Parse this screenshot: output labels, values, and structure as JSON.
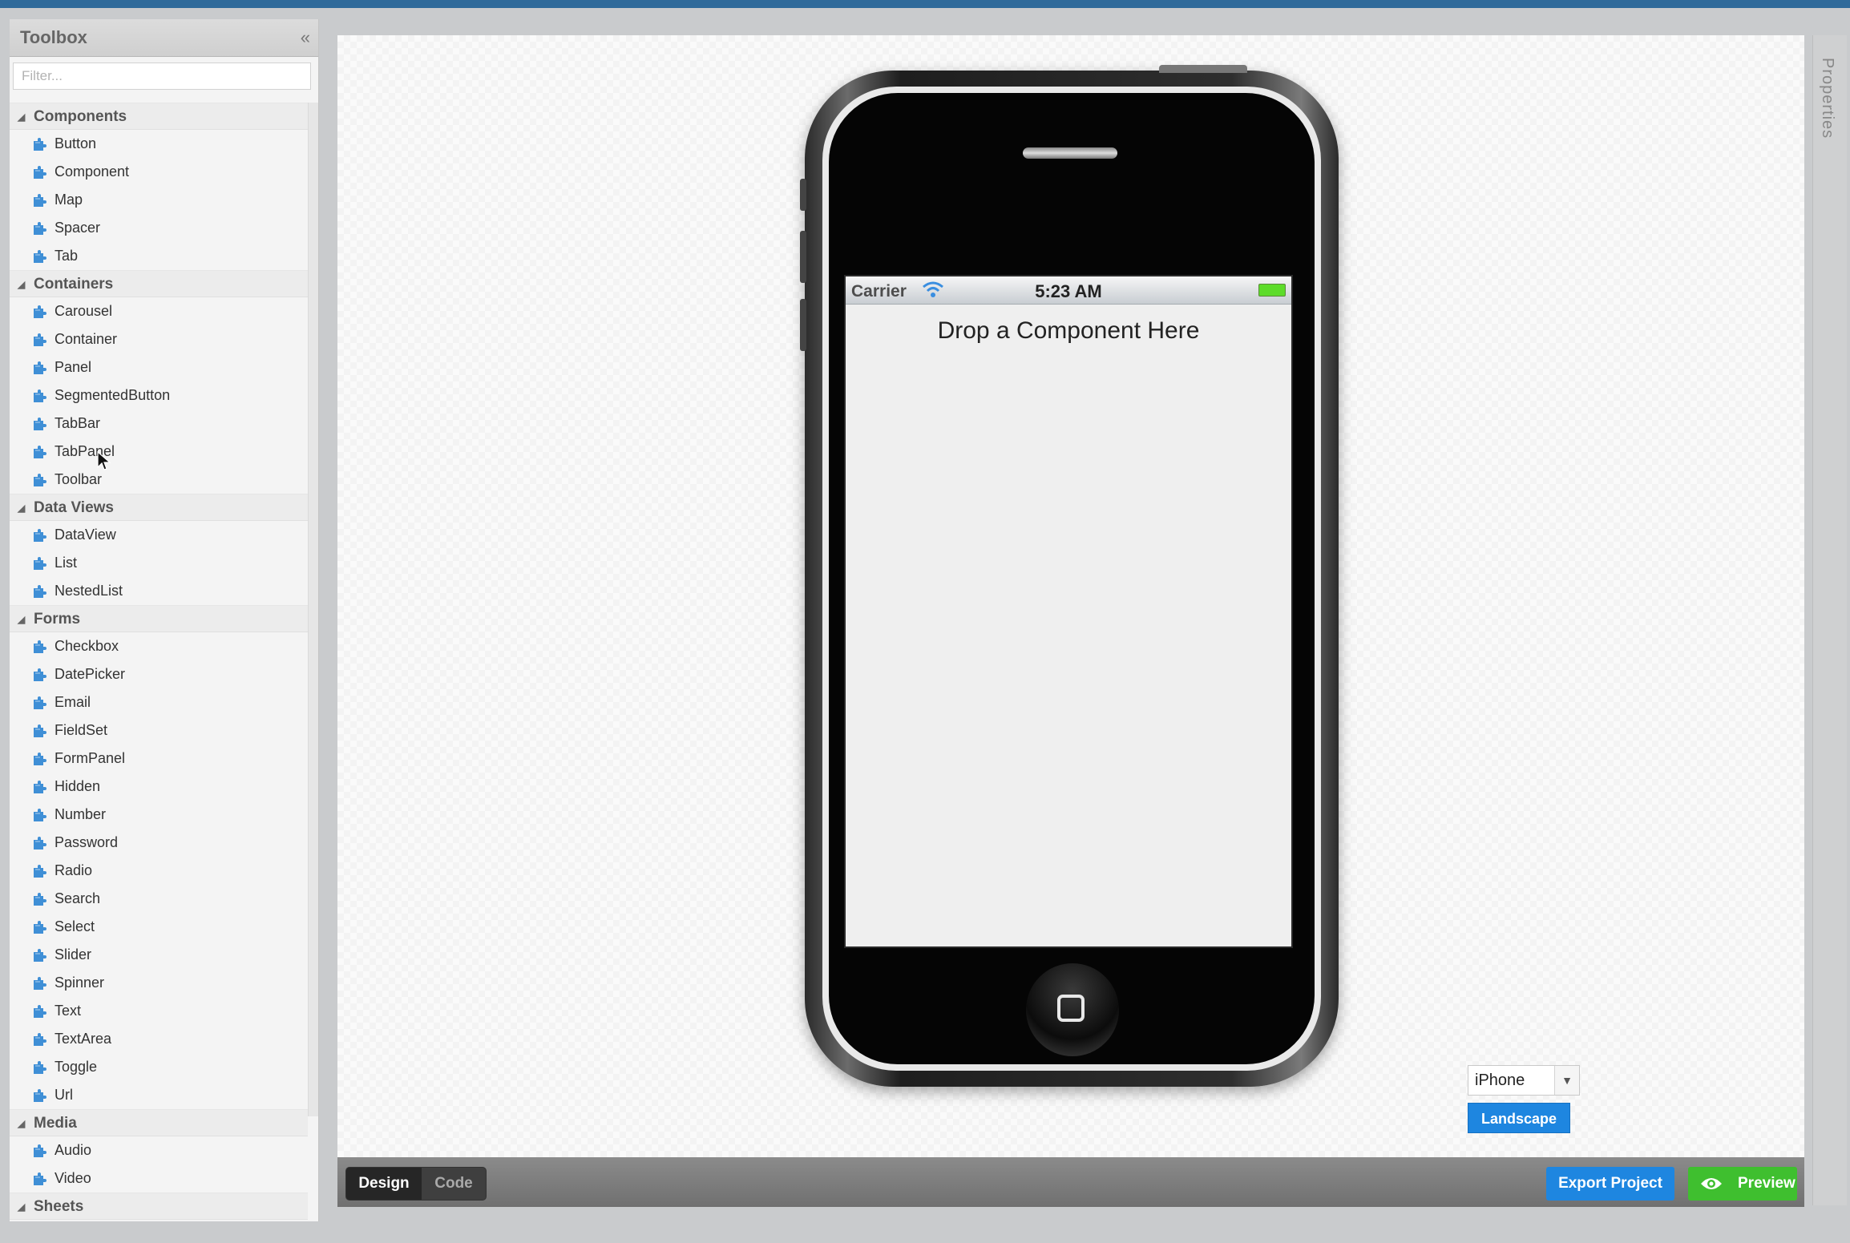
{
  "toolbox": {
    "title": "Toolbox",
    "collapse": "«",
    "filter_placeholder": "Filter...",
    "groups": [
      {
        "label": "Components",
        "items": [
          "Button",
          "Component",
          "Map",
          "Spacer",
          "Tab"
        ]
      },
      {
        "label": "Containers",
        "items": [
          "Carousel",
          "Container",
          "Panel",
          "SegmentedButton",
          "TabBar",
          "TabPanel",
          "Toolbar"
        ]
      },
      {
        "label": "Data Views",
        "items": [
          "DataView",
          "List",
          "NestedList"
        ]
      },
      {
        "label": "Forms",
        "items": [
          "Checkbox",
          "DatePicker",
          "Email",
          "FieldSet",
          "FormPanel",
          "Hidden",
          "Number",
          "Password",
          "Radio",
          "Search",
          "Select",
          "Slider",
          "Spinner",
          "Text",
          "TextArea",
          "Toggle",
          "Url"
        ]
      },
      {
        "label": "Media",
        "items": [
          "Audio",
          "Video"
        ]
      },
      {
        "label": "Sheets",
        "items": []
      }
    ]
  },
  "phone": {
    "carrier": "Carrier",
    "time": "5:23 AM",
    "drop_text": "Drop a Component Here"
  },
  "device": {
    "selected": "iPhone",
    "orientation_button": "Landscape"
  },
  "bottom": {
    "design_tab": "Design",
    "code_tab": "Code",
    "export_label": "Export Project",
    "preview_label": "Preview"
  },
  "properties": {
    "label": "Properties"
  },
  "colors": {
    "accent_blue": "#1e86e0",
    "preview_green": "#3fbf2f",
    "puzzle_icon": "#3f8fd6"
  }
}
